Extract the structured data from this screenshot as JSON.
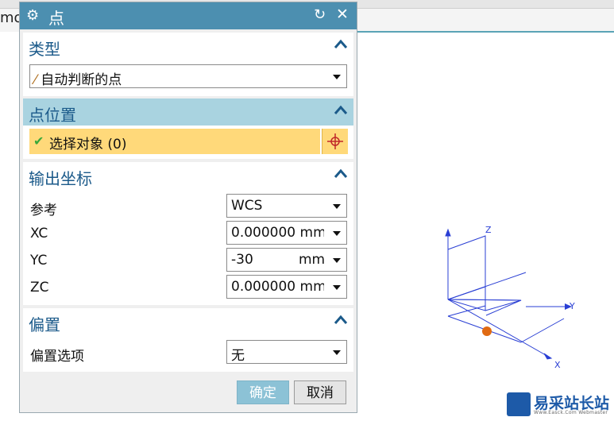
{
  "topbar": {
    "partial_text": "mo"
  },
  "dialog": {
    "title": "点",
    "sections": {
      "type": {
        "title": "类型",
        "dropdown_value": "自动判断的点"
      },
      "point_location": {
        "title": "点位置",
        "select_object": "选择对象 (0)"
      },
      "output_coords": {
        "title": "输出坐标",
        "reference": {
          "label": "参考",
          "value": "WCS"
        },
        "xc": {
          "label": "XC",
          "value": "0.000000 mm"
        },
        "yc": {
          "label": "YC",
          "value": "-30",
          "unit": "mm"
        },
        "zc": {
          "label": "ZC",
          "value": "0.000000 mm"
        }
      },
      "offset": {
        "title": "偏置",
        "option": {
          "label": "偏置选项",
          "value": "无"
        }
      }
    },
    "buttons": {
      "ok": "确定",
      "cancel": "取消"
    }
  },
  "triad": {
    "x": "X",
    "y": "Y",
    "z": "Z"
  },
  "watermark": {
    "text": "易采站长站",
    "sub": "Www.Easck.Com Webmaster"
  },
  "colors": {
    "titlebar": "#4c8fb0",
    "section_active": "#a9d3e0",
    "selection_row": "#ffd97a",
    "axis_blue": "#2a3fd4",
    "origin_orange": "#e06a12"
  },
  "icons": [
    "gear-icon",
    "reset-icon",
    "close-icon",
    "collapse-caret-icon",
    "point-type-icon",
    "check-icon",
    "crosshair-icon",
    "dropdown-arrow-icon",
    "watermark-logo-icon"
  ]
}
